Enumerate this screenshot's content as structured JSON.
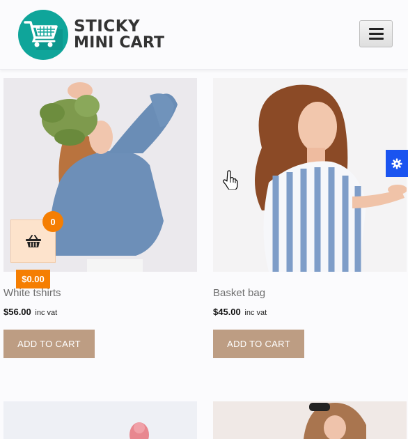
{
  "header": {
    "logo_line1": "STICKY",
    "logo_line2": "MINI CART",
    "logo_icon": "shopping-cart-icon",
    "menu_icon": "hamburger-menu-icon",
    "brand_color": "#0fa59a"
  },
  "products": [
    {
      "name": "White tshirts",
      "price": "$56.00",
      "vat": "inc vat",
      "button": "ADD TO CART"
    },
    {
      "name": "Basket bag",
      "price": "$45.00",
      "vat": "inc vat",
      "button": "ADD TO CART"
    }
  ],
  "sticky_cart": {
    "icon": "basket-icon",
    "count": "0",
    "total": "$0.00",
    "accent_color": "#f57e02"
  },
  "settings": {
    "icon": "gear-icon",
    "color": "#1a54f0"
  },
  "button_color": "#bd9d83"
}
